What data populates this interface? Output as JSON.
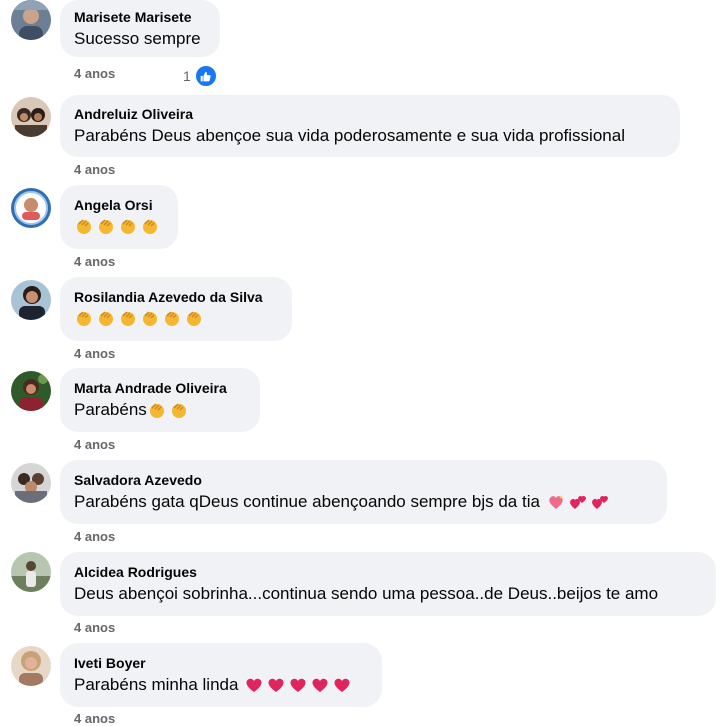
{
  "time_label": "4 anos",
  "comments": [
    {
      "author": "Marisete Marisete",
      "text": "Sucesso sempre",
      "time": "4 anos",
      "likes": "1"
    },
    {
      "author": "Andreluiz Oliveira",
      "text": "Parabéns Deus abençoe sua vida poderosamente e sua vida profissional",
      "time": "4 anos"
    },
    {
      "author": "Angela Orsi",
      "text": "",
      "emojis": [
        "clapping-hands",
        "clapping-hands",
        "clapping-hands",
        "clapping-hands"
      ],
      "time": "4 anos"
    },
    {
      "author": "Rosilandia Azevedo da Silva",
      "text": "",
      "emojis": [
        "clapping-hands",
        "clapping-hands",
        "clapping-hands",
        "clapping-hands",
        "clapping-hands",
        "clapping-hands"
      ],
      "time": "4 anos"
    },
    {
      "author": "Marta Andrade Oliveira",
      "text": "Parabéns",
      "emojis": [
        "clapping-hands",
        "clapping-hands"
      ],
      "time": "4 anos"
    },
    {
      "author": "Salvadora Azevedo",
      "text": "Parabéns gata qDeus continue abençoando sempre bjs da tia",
      "emojis": [
        "sparkling-heart",
        "two-hearts",
        "two-hearts"
      ],
      "time": "4 anos"
    },
    {
      "author": "Alcidea Rodrigues",
      "text": "Deus abençoi sobrinha...continua sendo uma pessoa..de Deus..beijos te amo",
      "time": "4 anos"
    },
    {
      "author": "Iveti Boyer",
      "text": "Parabéns minha linda",
      "emojis": [
        "red-heart",
        "red-heart",
        "red-heart",
        "red-heart",
        "red-heart"
      ],
      "time": "4 anos"
    }
  ],
  "colors": {
    "bubble": "#f0f2f5",
    "meta": "#65676b",
    "like": "#1877f2",
    "heart": "#e0245e",
    "clap": "#f5b731"
  }
}
